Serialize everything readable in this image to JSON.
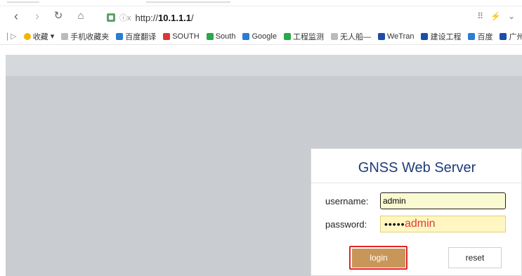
{
  "browser": {
    "url_prefix": "http://",
    "url_host": "10.1.1.1",
    "url_suffix": "/",
    "insecure_text": "ⓘx",
    "bookmarks": [
      {
        "label": "收藏",
        "icon": "star-icon"
      },
      {
        "label": "手机收藏夹",
        "icon": "phone-icon"
      },
      {
        "label": "百度翻译",
        "icon": "translate-icon"
      },
      {
        "label": "SOUTH",
        "icon": "south-logo-icon"
      },
      {
        "label": "South",
        "icon": "south-globe-icon"
      },
      {
        "label": "Google",
        "icon": "google-icon"
      },
      {
        "label": "工程监测",
        "icon": "monitor-icon"
      },
      {
        "label": "无人船—",
        "icon": "page-icon"
      },
      {
        "label": "WeTran",
        "icon": "wetran-icon"
      },
      {
        "label": "建设工程",
        "icon": "construction-icon"
      },
      {
        "label": "百度",
        "icon": "baidu-icon"
      },
      {
        "label": "广州南方",
        "icon": "guangzhou-icon"
      }
    ]
  },
  "login": {
    "title": "GNSS Web Server",
    "username_label": "username:",
    "password_label": "password:",
    "username_value": "admin",
    "password_mask": "•••••",
    "annotation": "admin",
    "login_button": "login",
    "reset_button": "reset"
  },
  "colors": {
    "accent": "#c9965a",
    "highlight": "#e32424",
    "title": "#1f3c78"
  }
}
